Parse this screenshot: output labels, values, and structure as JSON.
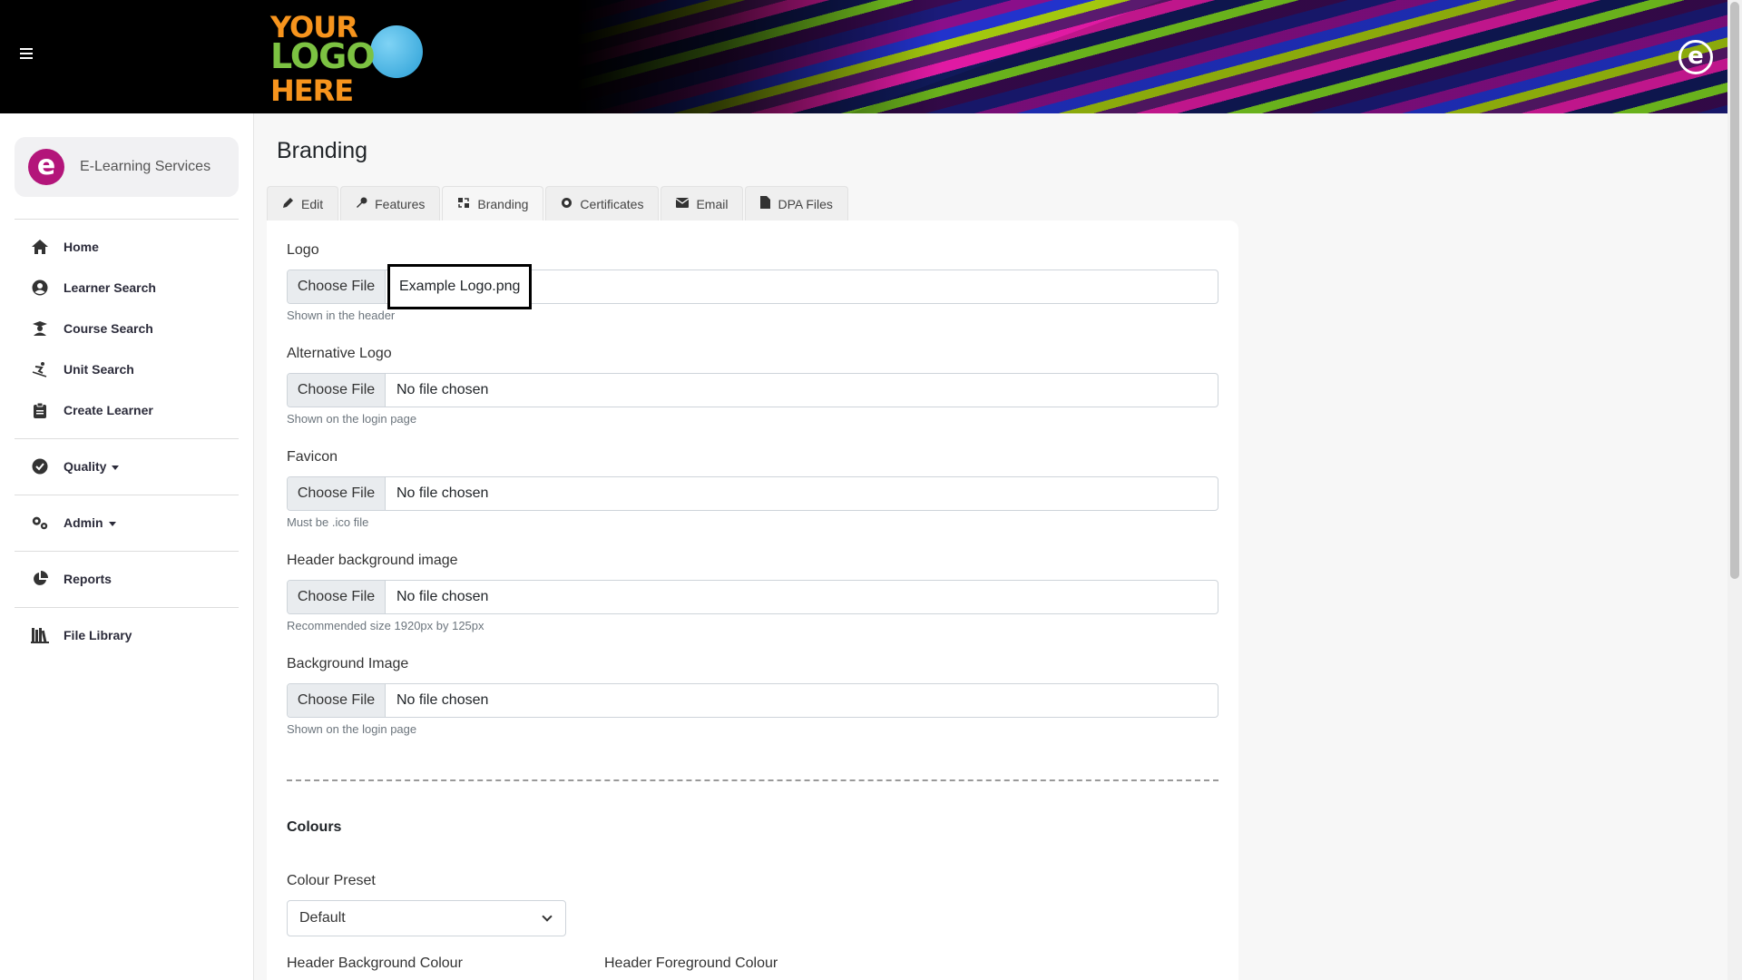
{
  "header": {
    "logo_lines": [
      "YOUR",
      "LOGO",
      "HERE"
    ],
    "corner_logo": "e"
  },
  "sidebar": {
    "brand_initial": "e",
    "brand_name": "E-Learning Services",
    "items": [
      {
        "label": "Home",
        "icon": "home-icon"
      },
      {
        "label": "Learner Search",
        "icon": "user-circle-icon"
      },
      {
        "label": "Course Search",
        "icon": "graduate-icon"
      },
      {
        "label": "Unit Search",
        "icon": "skier-icon"
      },
      {
        "label": "Create Learner",
        "icon": "clipboard-icon"
      },
      {
        "label": "Quality",
        "icon": "check-circle-icon"
      },
      {
        "label": "Admin",
        "icon": "gears-icon"
      },
      {
        "label": "Reports",
        "icon": "pie-chart-icon"
      },
      {
        "label": "File Library",
        "icon": "books-icon"
      }
    ]
  },
  "page": {
    "title": "Branding",
    "tabs": [
      {
        "label": "Edit",
        "icon": "pencil-icon"
      },
      {
        "label": "Features",
        "icon": "wrench-icon"
      },
      {
        "label": "Branding",
        "icon": "brush-icon"
      },
      {
        "label": "Certificates",
        "icon": "award-icon"
      },
      {
        "label": "Email",
        "icon": "envelope-icon"
      },
      {
        "label": "DPA Files",
        "icon": "file-icon"
      }
    ],
    "active_tab": "Branding"
  },
  "form": {
    "choose_file_label": "Choose File",
    "fields": [
      {
        "label": "Logo",
        "value": "Example Logo.png",
        "help": "Shown in the header"
      },
      {
        "label": "Alternative Logo",
        "value": "No file chosen",
        "help": "Shown on the login page"
      },
      {
        "label": "Favicon",
        "value": "No file chosen",
        "help": "Must be .ico file"
      },
      {
        "label": "Header background image",
        "value": "No file chosen",
        "help": "Recommended size 1920px by 125px"
      },
      {
        "label": "Background Image",
        "value": "No file chosen",
        "help": "Shown on the login page"
      }
    ],
    "colours_title": "Colours",
    "colour_preset_label": "Colour Preset",
    "colour_preset_value": "Default",
    "header_bg_colour_label": "Header Background Colour",
    "header_fg_colour_label": "Header Foreground Colour"
  },
  "colors": {
    "brand_magenta": "#b3157a",
    "logo_orange": "#f7941d",
    "logo_green": "#7cc242",
    "logo_blue": "#2a9fd6"
  }
}
